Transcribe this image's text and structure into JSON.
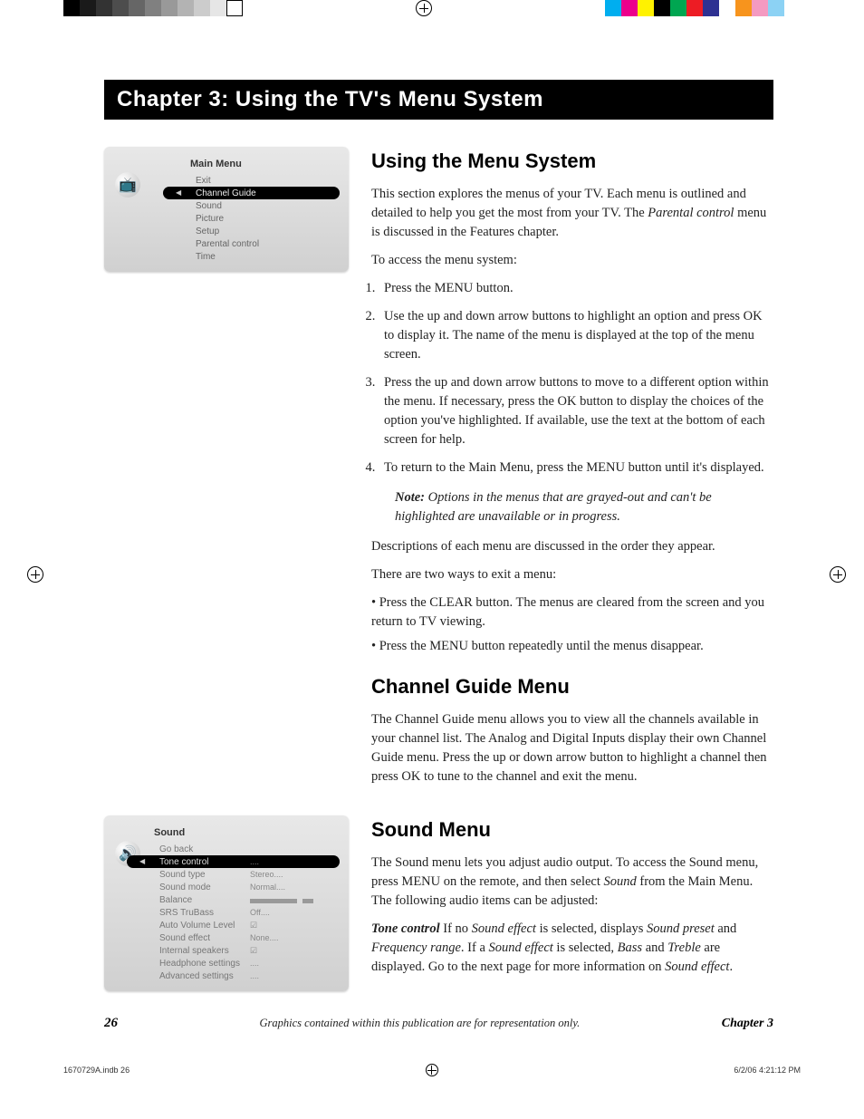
{
  "colorBarsLeft": [
    "#000",
    "#1a1a1a",
    "#333",
    "#4d4d4d",
    "#666",
    "#808080",
    "#999",
    "#b3b3b3",
    "#ccc",
    "#e6e6e6",
    "#fff"
  ],
  "colorBarsRight": [
    "#00aeef",
    "#ec008c",
    "#fff200",
    "#000",
    "#00a651",
    "#ed1c24",
    "#2e3192",
    "#fff",
    "#f7941d",
    "#f49ac1",
    "#8cd2f4",
    "#fff"
  ],
  "chapterBanner": "Chapter 3: Using the TV's Menu System",
  "mainMenu": {
    "title": "Main Menu",
    "items": [
      "Exit",
      "Channel Guide",
      "Sound",
      "Picture",
      "Setup",
      "Parental control",
      "Time"
    ],
    "highlightIndex": 1
  },
  "soundMenu": {
    "title": "Sound",
    "rows": [
      {
        "label": "Go back",
        "value": ""
      },
      {
        "label": "Tone control",
        "value": "....",
        "hl": true
      },
      {
        "label": "Sound type",
        "value": "Stereo...."
      },
      {
        "label": "Sound mode",
        "value": "Normal...."
      },
      {
        "label": "Balance",
        "value": "__slider__"
      },
      {
        "label": "SRS TruBass",
        "value": "Off...."
      },
      {
        "label": "Auto Volume Level",
        "value": "__check__"
      },
      {
        "label": "Sound effect",
        "value": "None...."
      },
      {
        "label": "Internal speakers",
        "value": "__check__"
      },
      {
        "label": "Headphone settings",
        "value": "...."
      },
      {
        "label": "Advanced settings",
        "value": "...."
      }
    ]
  },
  "sections": {
    "using": {
      "title": "Using the Menu System",
      "intro": "This section explores the menus of your TV. Each menu is outlined and detailed to help you get the most from your TV. The ",
      "introEm": "Parental control",
      "introEnd": " menu is discussed in the Features chapter.",
      "accessLine": "To access the menu system:",
      "steps": [
        "Press the MENU button.",
        "Use the up and down arrow buttons to highlight an option and press OK to display it. The name of the menu is displayed at the top of the menu screen.",
        "Press the up and down arrow buttons to move to a different option within the menu. If necessary, press the OK button to display the choices of the option you've highlighted. If available, use the text at the bottom of each screen for help.",
        "To return to the Main Menu, press the MENU button until it's displayed."
      ],
      "noteLabel": "Note:",
      "noteText": " Options in the menus that are grayed-out and can't be highlighted are unavailable or in progress.",
      "desc": "Descriptions of each menu are discussed in the order they appear.",
      "exitIntro": "There are two ways to exit a menu:",
      "bullet1": "• Press the CLEAR button. The menus are cleared from the screen and you return to TV viewing.",
      "bullet2": "• Press the MENU button repeatedly until the menus disappear."
    },
    "channel": {
      "title": "Channel Guide Menu",
      "body": "The Channel Guide menu allows you to view all the channels available in your channel list. The Analog and Digital Inputs display their own Channel Guide menu. Press the up or down arrow button to highlight a channel then press OK to tune to the channel and exit the menu."
    },
    "sound": {
      "title": "Sound Menu",
      "p1a": "The Sound menu lets you adjust audio output. To access the Sound menu, press MENU on the remote, and then select ",
      "p1em": "Sound",
      "p1b": " from the Main Menu. The following audio items can be adjusted:",
      "toneLabel": "Tone control",
      "toneA": "   If no ",
      "toneEm1": "Sound effect",
      "toneB": " is selected, displays ",
      "toneEm2": "Sound preset",
      "toneC": " and ",
      "toneEm3": "Frequency range",
      "toneD": ". If a ",
      "toneEm4": "Sound effect",
      "toneE": " is selected, ",
      "toneEm5": "Bass",
      "toneF": " and ",
      "toneEm6": "Treble",
      "toneG": " are displayed. Go to the next page for more information on ",
      "toneEm7": "Sound effect",
      "toneH": "."
    }
  },
  "footer": {
    "pageNum": "26",
    "center": "Graphics contained within this publication are for representation only.",
    "chapter": "Chapter 3"
  },
  "print": {
    "left": "1670729A.indb   26",
    "right": "6/2/06   4:21:12 PM"
  }
}
